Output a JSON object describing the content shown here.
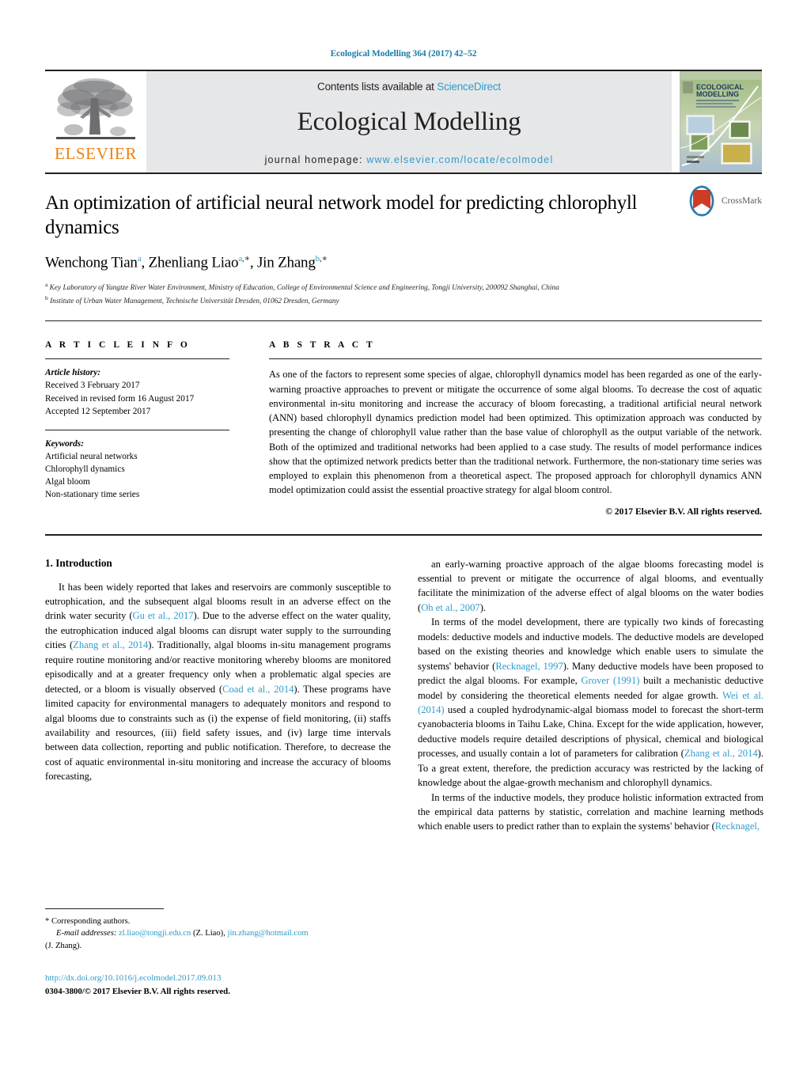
{
  "running_head": "Ecological Modelling 364 (2017) 42–52",
  "masthead": {
    "publisher_name": "ELSEVIER",
    "contents_prefix": "Contents lists available at ",
    "contents_link": "ScienceDirect",
    "journal_title": "Ecological Modelling",
    "homepage_prefix": "journal homepage: ",
    "homepage_url": "www.elsevier.com/locate/ecolmodel",
    "cover_title_line1": "ECOLOGICAL",
    "cover_title_line2": "MODELLING"
  },
  "article": {
    "title": "An optimization of artificial neural network model for predicting chlorophyll dynamics",
    "crossmark_label": "CrossMark",
    "authors": [
      {
        "name": "Wenchong Tian",
        "sup": "a",
        "star": false,
        "sep": ", "
      },
      {
        "name": "Zhenliang Liao",
        "sup": "a",
        "star": true,
        "sep": ", "
      },
      {
        "name": "Jin Zhang",
        "sup": "b",
        "star": true,
        "sep": ""
      }
    ],
    "affiliations": [
      {
        "marker": "a",
        "text": "Key Laboratory of Yangtze River Water Environment, Ministry of Education, College of Environmental Science and Engineering, Tongji University, 200092 Shanghai, China"
      },
      {
        "marker": "b",
        "text": "Institute of Urban Water Management, Technische Universität Dresden, 01062 Dresden, Germany"
      }
    ]
  },
  "article_info": {
    "heading": "A R T I C L E   I N F O",
    "history_label": "Article history:",
    "history": [
      "Received 3 February 2017",
      "Received in revised form 16 August 2017",
      "Accepted 12 September 2017"
    ],
    "keywords_label": "Keywords:",
    "keywords": [
      "Artificial neural networks",
      "Chlorophyll dynamics",
      "Algal bloom",
      "Non-stationary time series"
    ]
  },
  "abstract": {
    "heading": "A B S T R A C T",
    "text": "As one of the factors to represent some species of algae, chlorophyll dynamics model has been regarded as one of the early-warning proactive approaches to prevent or mitigate the occurrence of some algal blooms. To decrease the cost of aquatic environmental in-situ monitoring and increase the accuracy of bloom forecasting, a traditional artificial neural network (ANN) based chlorophyll dynamics prediction model had been optimized. This optimization approach was conducted by presenting the change of chlorophyll value rather than the base value of chlorophyll as the output variable of the network. Both of the optimized and traditional networks had been applied to a case study. The results of model performance indices show that the optimized network predicts better than the traditional network. Furthermore, the non-stationary time series was employed to explain this phenomenon from a theoretical aspect. The proposed approach for chlorophyll dynamics ANN model optimization could assist the essential proactive strategy for algal bloom control.",
    "copyright": "© 2017 Elsevier B.V. All rights reserved."
  },
  "body": {
    "section_title": "1.  Introduction",
    "left_paragraphs": [
      "It has been widely reported that lakes and reservoirs are commonly susceptible to eutrophication, and the subsequent algal blooms result in an adverse effect on the drink water security (@Gu et al., 2017@). Due to the adverse effect on the water quality, the eutrophication induced algal blooms can disrupt water supply to the surrounding cities (@Zhang et al., 2014@). Traditionally, algal blooms in-situ management programs require routine monitoring and/or reactive monitoring whereby blooms are monitored episodically and at a greater frequency only when a problematic algal species are detected, or a bloom is visually observed (@Coad et al., 2014@). These programs have limited capacity for environmental managers to adequately monitors and respond to algal blooms due to constraints such as (i) the expense of field monitoring, (ii) staffs availability and resources, (iii) field safety issues, and (iv) large time intervals between data collection, reporting and public notification. Therefore, to decrease the cost of aquatic environmental in-situ monitoring and increase the accuracy of blooms forecasting,"
    ],
    "right_paragraphs": [
      "an early-warning proactive approach of the algae blooms forecasting model is essential to prevent or mitigate the occurrence of algal blooms, and eventually facilitate the minimization of the adverse effect of algal blooms on the water bodies (@Oh et al., 2007@).",
      "In terms of the model development, there are typically two kinds of forecasting models: deductive models and inductive models. The deductive models are developed based on the existing theories and knowledge which enable users to simulate the systems' behavior (@Recknagel, 1997@). Many deductive models have been proposed to predict the algal blooms. For example, @Grover (1991)@ built a mechanistic deductive model by considering the theoretical elements needed for algae growth. @Wei et al. (2014)@ used a coupled hydrodynamic-algal biomass model to forecast the short-term cyanobacteria blooms in Taihu Lake, China. Except for the wide application, however, deductive models require detailed descriptions of physical, chemical and biological processes, and usually contain a lot of parameters for calibration (@Zhang et al., 2014@). To a great extent, therefore, the prediction accuracy was restricted by the lacking of knowledge about the algae-growth mechanism and chlorophyll dynamics.",
      "In terms of the inductive models, they produce holistic information extracted from the empirical data patterns by statistic, correlation and machine learning methods which enable users to predict rather than to explain the systems' behavior (@Recknagel,@"
    ]
  },
  "footnotes": {
    "corresponding": "* Corresponding authors.",
    "email_label": "E-mail addresses:",
    "emails": [
      {
        "address": "zl.liao@tongji.edu.cn",
        "owner": " (Z. Liao), "
      },
      {
        "address": "jin.zhang@hotmail.com",
        "owner": ""
      }
    ],
    "email_tail": "(J. Zhang).",
    "doi": "http://dx.doi.org/10.1016/j.ecolmodel.2017.09.013",
    "issn_line": "0304-3800/© 2017 Elsevier B.V. All rights reserved."
  },
  "colors": {
    "link_blue": "#2e9ccc",
    "running_head_blue": "#1a7ca8",
    "elsevier_orange": "#f07f13",
    "band_gray": "#e6e7e8"
  }
}
